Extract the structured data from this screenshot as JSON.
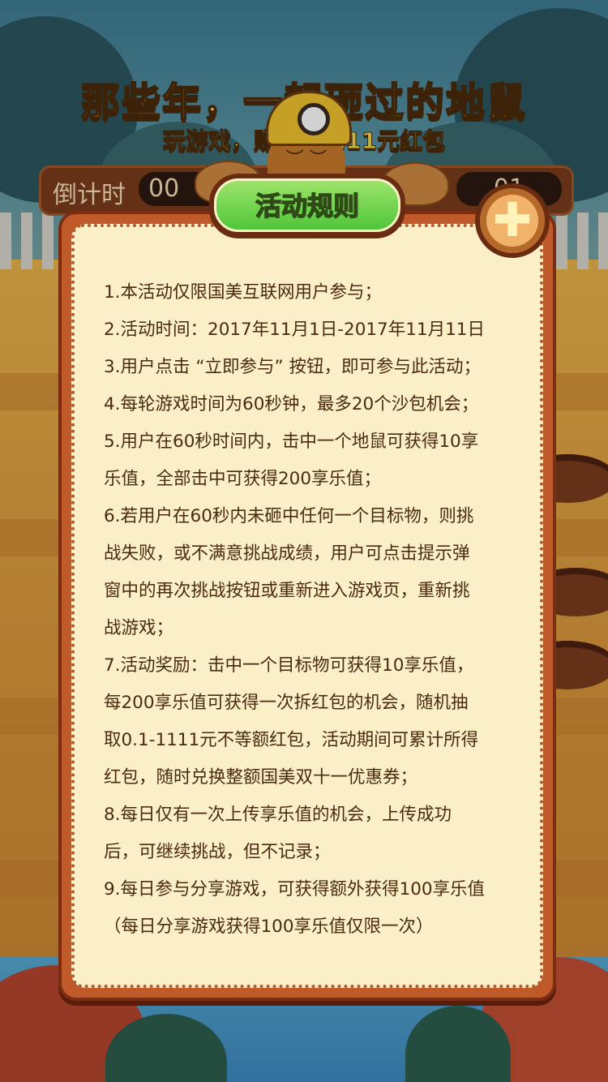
{
  "game": {
    "title": "那些年，一起砸过的地鼠",
    "subtitle": "玩游戏，赚乐享 111元红包",
    "countdown_label": "倒计时",
    "countdown_value": "00",
    "score_value": "01"
  },
  "modal": {
    "title": "活动规则",
    "close_icon": "close-icon",
    "rules": [
      "1.本活动仅限国美互联网用户参与；",
      "2.活动时间：2017年11月1日-2017年11月11日",
      "3.用户点击 “立即参与” 按钮，即可参与此活动；",
      "4.每轮游戏时间为60秒钟，最多20个沙包机会；",
      "5.用户在60秒时间内，击中一个地鼠可获得10享",
      "乐值，全部击中可获得200享乐值；",
      "6.若用户在60秒内未砸中任何一个目标物，则挑",
      "战失败，或不满意挑战成绩，用户可点击提示弹",
      "窗中的再次挑战按钮或重新进入游戏页，重新挑",
      "战游戏；",
      "7.活动奖励：击中一个目标物可获得10享乐值，",
      "每200享乐值可获得一次拆红包的机会，随机抽",
      "取0.1-1111元不等额红包，活动期间可累计所得",
      "红包，随时兑换整额国美双十一优惠券；",
      "8.每日仅有一次上传享乐值的机会，上传成功",
      "后，可继续挑战，但不记录；",
      "9.每日参与分享游戏，可获得额外获得100享乐值",
      "（每日分享游戏获得100享乐值仅限一次）"
    ]
  },
  "colors": {
    "title_gold": "#f3d74a",
    "banner_green": "#4fc63a",
    "modal_frame": "#c05a2a",
    "paper": "#fbefc7"
  }
}
